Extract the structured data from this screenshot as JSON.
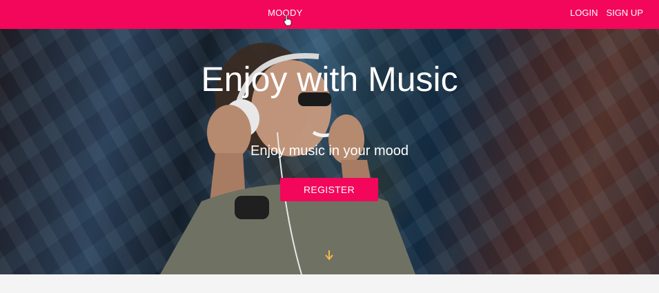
{
  "header": {
    "brand": "MOODY",
    "nav": [
      {
        "label": "LOGIN"
      },
      {
        "label": "SIGN UP"
      }
    ],
    "color": "#f2075a"
  },
  "hero": {
    "title": "Enjoy with Music",
    "subtitle": "Enjoy music in your mood",
    "cta_label": "REGISTER",
    "scroll_icon": "arrow-down-icon"
  }
}
